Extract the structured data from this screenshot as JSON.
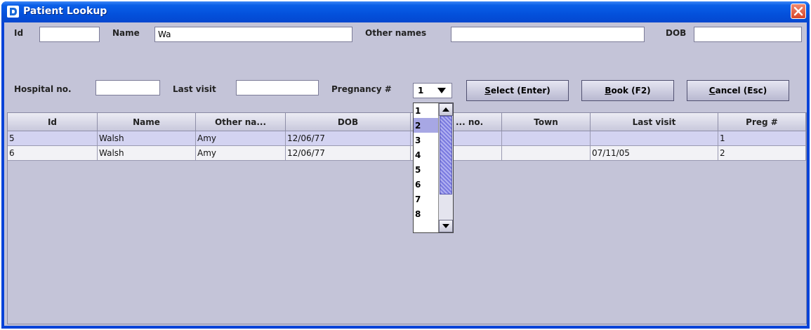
{
  "window": {
    "title": "Patient Lookup",
    "title_bar_color": "#0451dc",
    "client_background": "#c4c4d8",
    "close_button_color": "#d8462a"
  },
  "icons": {
    "app": "app-logo-icon",
    "close": "close-icon",
    "dropdown": "chevron-down-icon",
    "scroll_up": "arrow-up-icon",
    "scroll_down": "arrow-down-icon"
  },
  "form": {
    "id_label": "Id",
    "id_value": "",
    "name_label": "Name",
    "name_value": "Wa",
    "other_names_label": "Other names",
    "other_names_value": "",
    "dob_label": "DOB",
    "dob_value": "",
    "hospital_no_label": "Hospital no.",
    "hospital_no_value": "",
    "last_visit_label": "Last visit",
    "last_visit_value": "",
    "pregnancy_label": "Pregnancy #",
    "pregnancy_value": "1"
  },
  "buttons": {
    "select_mnemonic": "S",
    "select_rest": "elect (Enter)",
    "book_mnemonic": "B",
    "book_rest": "ook (F2)",
    "cancel_mnemonic": "C",
    "cancel_rest": "ancel (Esc)"
  },
  "pregnancy_dropdown": {
    "options": [
      "1",
      "2",
      "3",
      "4",
      "5",
      "6",
      "7",
      "8"
    ],
    "highlighted": "2",
    "selection_color": "#a7a7e4"
  },
  "table": {
    "columns": [
      "Id",
      "Name",
      "Other na...",
      "DOB",
      "... no.",
      "Town",
      "Last visit",
      "Preg #"
    ],
    "rows": [
      {
        "id": "5",
        "name": "Walsh",
        "other_names": "Amy",
        "dob": "12/06/77",
        "hospital_no": "",
        "town": "",
        "last_visit": "",
        "preg": "1",
        "highlighted": true
      },
      {
        "id": "6",
        "name": "Walsh",
        "other_names": "Amy",
        "dob": "12/06/77",
        "hospital_no": "",
        "town": "",
        "last_visit": "07/11/05",
        "preg": "2",
        "highlighted": false
      }
    ],
    "row_highlight_color": "#d3d3f1",
    "row_color": "#f2f2f6"
  }
}
